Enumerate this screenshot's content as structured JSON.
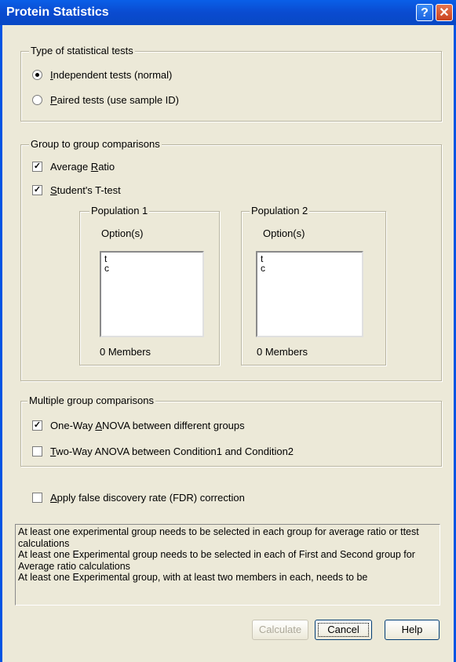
{
  "window": {
    "title": "Protein Statistics",
    "help_icon": "?",
    "close_icon": "✕"
  },
  "tests_group": {
    "legend": "Type of statistical tests",
    "independent": {
      "pre": "",
      "ul": "I",
      "post": "ndependent tests (normal)",
      "selected": true
    },
    "paired": {
      "pre": "",
      "ul": "P",
      "post": "aired tests (use sample ID)",
      "selected": false
    }
  },
  "group_comparisons": {
    "legend": "Group to group comparisons",
    "average_ratio": {
      "pre": "Average ",
      "ul": "R",
      "post": "atio",
      "checked": true
    },
    "ttest": {
      "pre": "",
      "ul": "S",
      "post": "tudent's T-test",
      "checked": true
    },
    "population1": {
      "legend": "Population 1",
      "label": "Option(s)",
      "items": [
        "t",
        "c"
      ],
      "members": "0 Members"
    },
    "population2": {
      "legend": "Population 2",
      "label": "Option(s)",
      "items": [
        "t",
        "c"
      ],
      "members": "0 Members"
    }
  },
  "multiple_comparisons": {
    "legend": "Multiple group comparisons",
    "oneway": {
      "pre": "One-Way ",
      "ul": "A",
      "post": "NOVA between different groups",
      "checked": true
    },
    "twoway": {
      "pre": "",
      "ul": "T",
      "post": "wo-Way ANOVA between Condition1 and Condition2",
      "checked": false
    }
  },
  "fdr": {
    "pre": "",
    "ul": "A",
    "post": "pply false discovery rate (FDR) correction",
    "checked": false
  },
  "messages": [
    "At least one experimental group needs to be selected in each group for average ratio or ttest calculations",
    "At least one Experimental group needs to be selected in each of First and Second group for Average ratio calculations",
    "At least one Experimental group, with at least two members in each, needs to be"
  ],
  "buttons": {
    "calculate": "Calculate",
    "cancel": "Cancel",
    "help": "Help"
  }
}
